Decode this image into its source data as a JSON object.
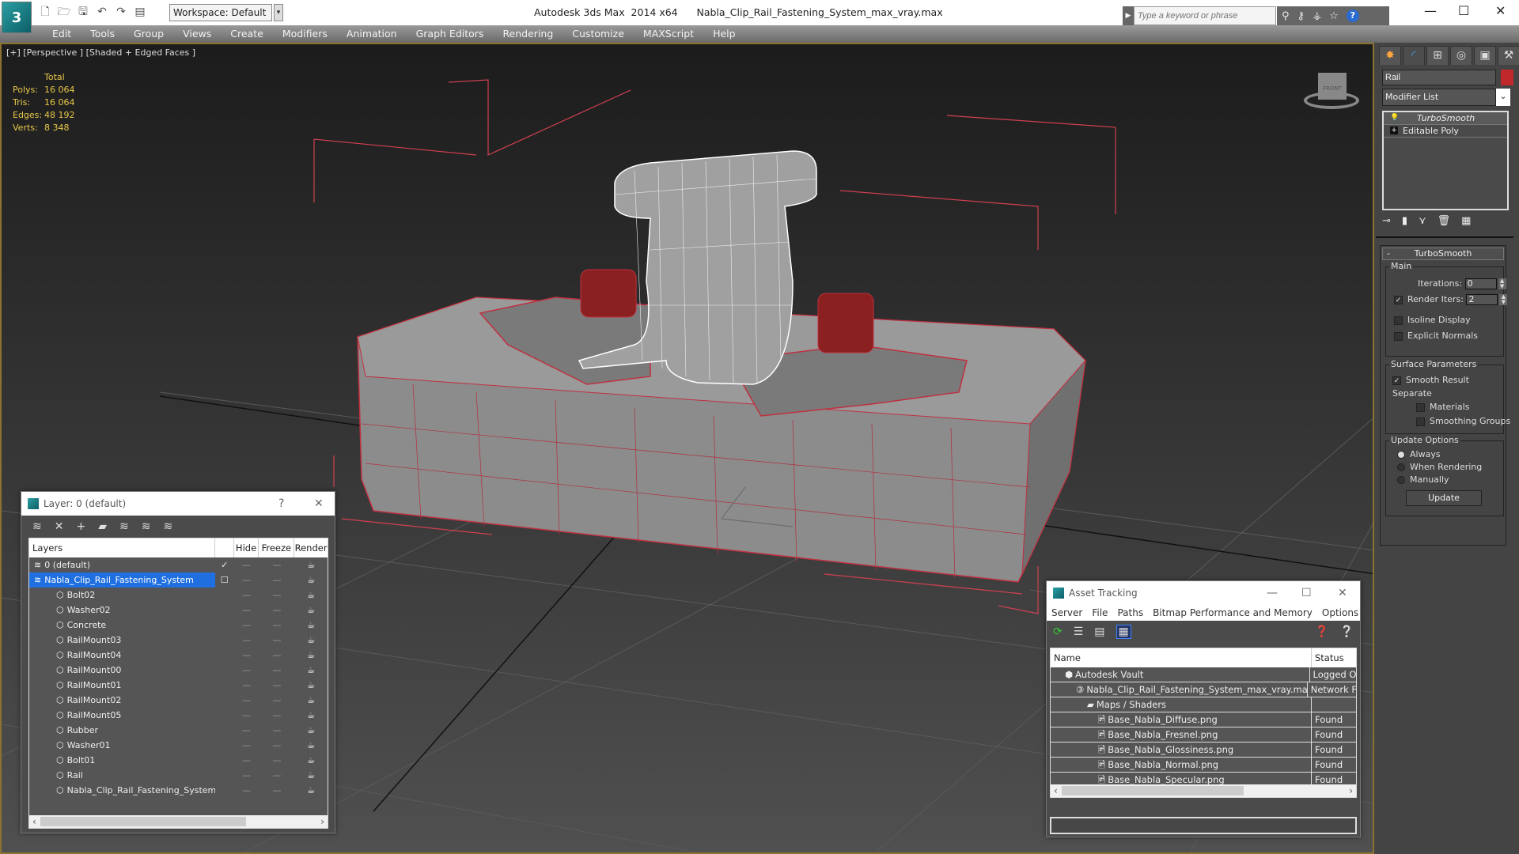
{
  "app": {
    "title": "Autodesk 3ds Max  2014 x64",
    "file": "Nabla_Clip_Rail_Fastening_System_max_vray.max",
    "workspace": "Workspace: Default",
    "search_placeholder": "Type a keyword or phrase"
  },
  "menu": [
    "Edit",
    "Tools",
    "Group",
    "Views",
    "Create",
    "Modifiers",
    "Animation",
    "Graph Editors",
    "Rendering",
    "Customize",
    "MAXScript",
    "Help"
  ],
  "viewport": {
    "label": "[+] [Perspective ] [Shaded + Edged Faces ]",
    "stats": {
      "header": "Total",
      "rows": [
        {
          "k": "Polys:",
          "v": "16 064"
        },
        {
          "k": "Tris:",
          "v": "16 064"
        },
        {
          "k": "Edges:",
          "v": "48 192"
        },
        {
          "k": "Verts:",
          "v": "8 348"
        }
      ]
    },
    "viewcube_label": "FRONT"
  },
  "command_panel": {
    "object_name": "Rail",
    "object_color": "#c0282c",
    "modifier_list": "Modifier List",
    "stack": [
      "TurboSmooth",
      "Editable Poly"
    ],
    "rollout_title": "TurboSmooth",
    "main": {
      "title": "Main",
      "iterations_label": "Iterations:",
      "iterations": "0",
      "render_iters_label": "Render Iters:",
      "render_iters": "2",
      "render_iters_checked": true,
      "isoline": "Isoline Display",
      "explicit_normals": "Explicit Normals"
    },
    "surface": {
      "title": "Surface Parameters",
      "smooth_result": "Smooth Result",
      "separate": "Separate",
      "materials": "Materials",
      "smoothing_groups": "Smoothing Groups"
    },
    "update": {
      "title": "Update Options",
      "always": "Always",
      "when_rendering": "When Rendering",
      "manually": "Manually",
      "selected": "Always",
      "button": "Update"
    }
  },
  "layer_dialog": {
    "title": "Layer: 0 (default)",
    "columns": [
      "Layers",
      "",
      "Hide",
      "Freeze",
      "Render"
    ],
    "rows": [
      {
        "name": "0 (default)",
        "level": 0,
        "type": "layer",
        "current": true
      },
      {
        "name": "Nabla_Clip_Rail_Fastening_System",
        "level": 0,
        "type": "layer",
        "selected": true
      },
      {
        "name": "Bolt02",
        "level": 1,
        "type": "object"
      },
      {
        "name": "Washer02",
        "level": 1,
        "type": "object"
      },
      {
        "name": "Concrete",
        "level": 1,
        "type": "object"
      },
      {
        "name": "RailMount03",
        "level": 1,
        "type": "object"
      },
      {
        "name": "RailMount04",
        "level": 1,
        "type": "object"
      },
      {
        "name": "RailMount00",
        "level": 1,
        "type": "object"
      },
      {
        "name": "RailMount01",
        "level": 1,
        "type": "object"
      },
      {
        "name": "RailMount02",
        "level": 1,
        "type": "object"
      },
      {
        "name": "RailMount05",
        "level": 1,
        "type": "object"
      },
      {
        "name": "Rubber",
        "level": 1,
        "type": "object"
      },
      {
        "name": "Washer01",
        "level": 1,
        "type": "object"
      },
      {
        "name": "Bolt01",
        "level": 1,
        "type": "object"
      },
      {
        "name": "Rail",
        "level": 1,
        "type": "object"
      },
      {
        "name": "Nabla_Clip_Rail_Fastening_System",
        "level": 1,
        "type": "object"
      }
    ]
  },
  "asset_dialog": {
    "title": "Asset Tracking",
    "menu": [
      "Server",
      "File",
      "Paths",
      "Bitmap Performance and Memory",
      "Options"
    ],
    "columns": [
      "Name",
      "Status"
    ],
    "rows": [
      {
        "name": "Autodesk Vault",
        "status": "Logged O",
        "level": 1
      },
      {
        "name": "Nabla_Clip_Rail_Fastening_System_max_vray.max",
        "status": "Network F",
        "level": 2
      },
      {
        "name": "Maps / Shaders",
        "status": "",
        "level": 3
      },
      {
        "name": "Base_Nabla_Diffuse.png",
        "status": "Found",
        "level": 4
      },
      {
        "name": "Base_Nabla_Fresnel.png",
        "status": "Found",
        "level": 4
      },
      {
        "name": "Base_Nabla_Glossiness.png",
        "status": "Found",
        "level": 4
      },
      {
        "name": "Base_Nabla_Normal.png",
        "status": "Found",
        "level": 4
      },
      {
        "name": "Base_Nabla_Specular.png",
        "status": "Found",
        "level": 4
      }
    ]
  }
}
